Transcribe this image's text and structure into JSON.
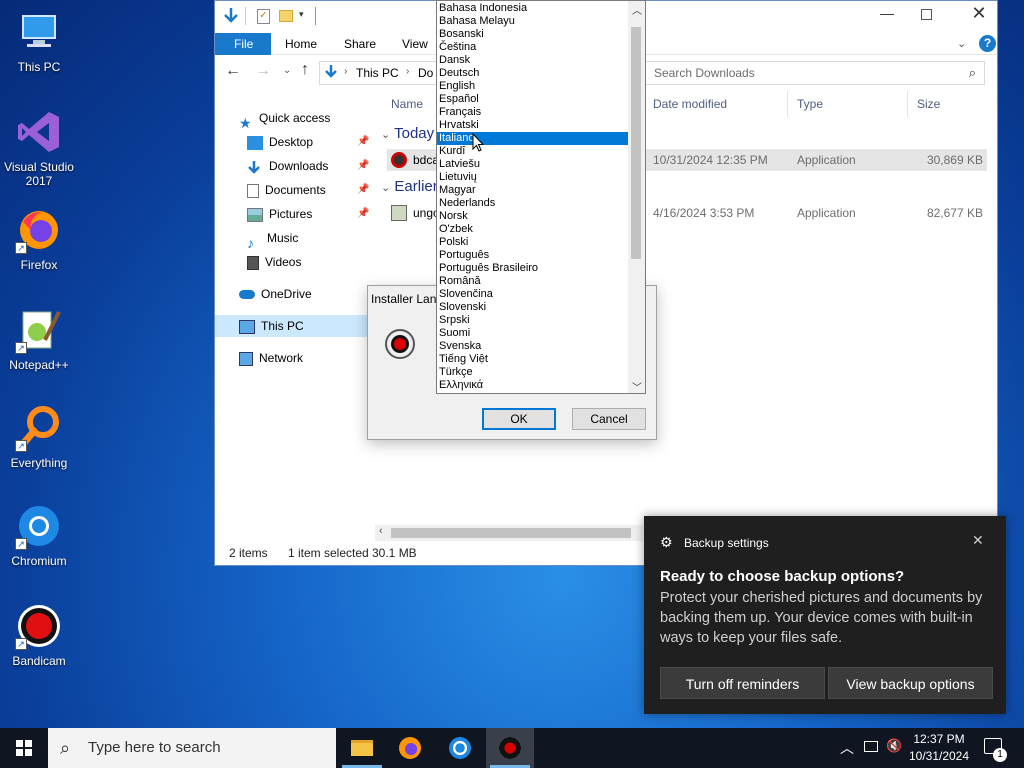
{
  "desktop": {
    "icons": [
      {
        "label": "This PC"
      },
      {
        "label": "Visual Studio 2017"
      },
      {
        "label": "Firefox"
      },
      {
        "label": "Notepad++"
      },
      {
        "label": "Everything"
      },
      {
        "label": "Chromium"
      },
      {
        "label": "Bandicam"
      }
    ]
  },
  "explorer": {
    "ribbon_tabs": [
      "File",
      "Home",
      "Share",
      "View"
    ],
    "breadcrumb": [
      "This PC",
      "Do"
    ],
    "search_placeholder": "Search Downloads",
    "nav": {
      "quick_access": "Quick access",
      "items": [
        "Desktop",
        "Downloads",
        "Documents",
        "Pictures",
        "Music",
        "Videos"
      ],
      "onedrive": "OneDrive",
      "this_pc": "This PC",
      "network": "Network"
    },
    "columns": {
      "name": "Name",
      "date": "Date modified",
      "type": "Type",
      "size": "Size"
    },
    "groups": [
      {
        "label": "Today",
        "file": {
          "name": "bdca",
          "date": "10/31/2024 12:35 PM",
          "type": "Application",
          "size": "30,869 KB"
        }
      },
      {
        "label": "Earlier",
        "file": {
          "name": "ungo",
          "date": "4/16/2024 3:53 PM",
          "type": "Application",
          "size": "82,677 KB"
        }
      }
    ],
    "status": {
      "items": "2 items",
      "selected": "1 item selected",
      "size": "30.1 MB"
    }
  },
  "installer": {
    "title": "Installer Lan",
    "ok": "OK",
    "cancel": "Cancel"
  },
  "languages": {
    "items": [
      "Bahasa Indonesia",
      "Bahasa Melayu",
      "Bosanski",
      "Čeština",
      "Dansk",
      "Deutsch",
      "English",
      "Español",
      "Français",
      "Hrvatski",
      "Italiano",
      "Kurdî",
      "Latviešu",
      "Lietuvių",
      "Magyar",
      "Nederlands",
      "Norsk",
      "O'zbek",
      "Polski",
      "Português",
      "Português Brasileiro",
      "Română",
      "Slovenčina",
      "Slovenski",
      "Srpski",
      "Suomi",
      "Svenska",
      "Tiếng Việt",
      "Türkçe",
      "Ελληνικά"
    ],
    "selected": "Italiano"
  },
  "toast": {
    "app": "Backup settings",
    "title": "Ready to choose backup options?",
    "body": "Protect your cherished pictures and documents by backing them up. Your device comes with built-in ways to keep your files safe.",
    "btn_off": "Turn off reminders",
    "btn_view": "View backup options"
  },
  "taskbar": {
    "search_placeholder": "Type here to search",
    "time": "12:37 PM",
    "date": "10/31/2024",
    "notification_count": "1"
  }
}
